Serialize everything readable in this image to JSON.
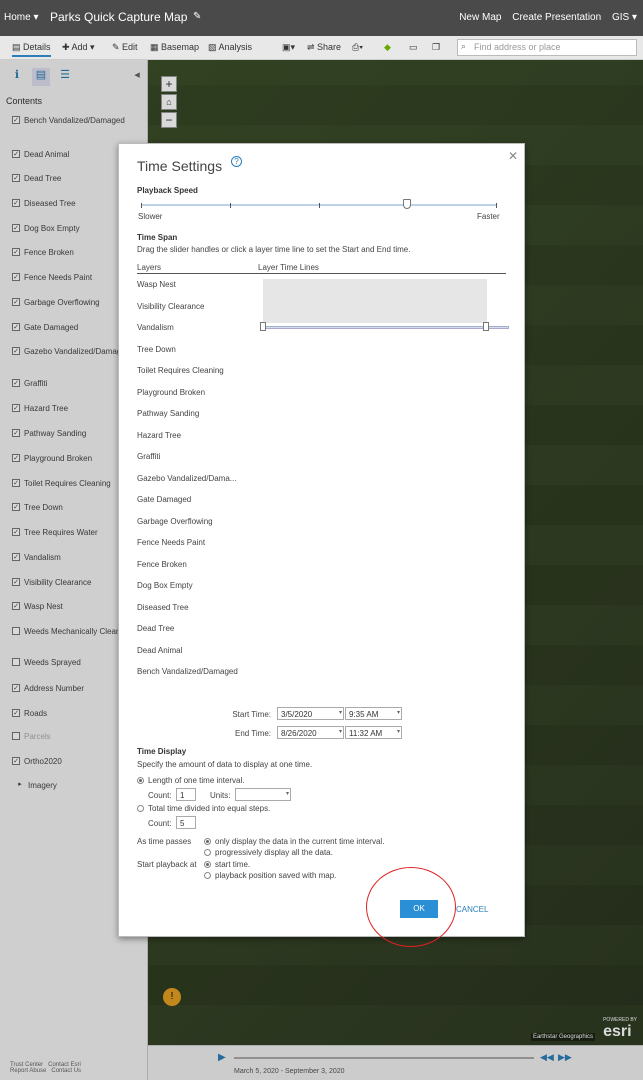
{
  "header": {
    "home_label": "Home ▾",
    "map_title": "Parks Quick Capture Map",
    "new_map": "New Map",
    "create_presentation": "Create Presentation",
    "user": "GIS ▾"
  },
  "toolbar": {
    "details": "Details",
    "add": "Add ▾",
    "edit": "Edit",
    "basemap": "Basemap",
    "analysis": "Analysis",
    "share": "Share",
    "search_placeholder": "Find address or place"
  },
  "sidebar": {
    "contents_label": "Contents",
    "layers": [
      {
        "label": "Bench Vandalized/Damaged",
        "checked": true
      },
      {
        "label": "Dead Animal",
        "checked": true
      },
      {
        "label": "Dead Tree",
        "checked": true
      },
      {
        "label": "Diseased Tree",
        "checked": true
      },
      {
        "label": "Dog Box Empty",
        "checked": true
      },
      {
        "label": "Fence Broken",
        "checked": true
      },
      {
        "label": "Fence Needs Paint",
        "checked": true
      },
      {
        "label": "Garbage Overflowing",
        "checked": true
      },
      {
        "label": "Gate Damaged",
        "checked": true
      },
      {
        "label": "Gazebo Vandalized/Damaged",
        "checked": true
      },
      {
        "label": "Graffiti",
        "checked": true
      },
      {
        "label": "Hazard Tree",
        "checked": true
      },
      {
        "label": "Pathway Sanding",
        "checked": true
      },
      {
        "label": "Playground Broken",
        "checked": true
      },
      {
        "label": "Toilet Requires Cleaning",
        "checked": true
      },
      {
        "label": "Tree Down",
        "checked": true
      },
      {
        "label": "Tree Requires Water",
        "checked": true
      },
      {
        "label": "Vandalism",
        "checked": true
      },
      {
        "label": "Visibility Clearance",
        "checked": true
      },
      {
        "label": "Wasp Nest",
        "checked": true
      },
      {
        "label": "Weeds Mechanically Cleared",
        "checked": false
      },
      {
        "label": "Weeds Sprayed",
        "checked": false
      },
      {
        "label": "Address Number",
        "checked": true
      },
      {
        "label": "Roads",
        "checked": true
      },
      {
        "label": "Parcels",
        "checked": false
      },
      {
        "label": "Ortho2020",
        "checked": true
      },
      {
        "label": "Imagery",
        "checked": false
      }
    ],
    "footer_trust": "Trust Center",
    "footer_contact": "Contact Esri",
    "footer_report": "Report Abuse",
    "footer_contact_us": "Contact Us"
  },
  "map": {
    "attribution": "Earthstar Geographics",
    "esri_powered": "POWERED BY",
    "esri": "esri"
  },
  "timebar": {
    "range_label": "March 5, 2020 - September 3, 2020"
  },
  "dialog": {
    "title": "Time Settings",
    "playback_speed_label": "Playback Speed",
    "slower": "Slower",
    "faster": "Faster",
    "time_span_label": "Time Span",
    "time_span_help": "Drag the slider handles or click a layer time line to set the Start and End time.",
    "col_layers": "Layers",
    "col_timelines": "Layer Time Lines",
    "layer_list": [
      "Wasp Nest",
      "Visibility Clearance",
      "Vandalism",
      "Tree Down",
      "Toilet Requires Cleaning",
      "Playground Broken",
      "Pathway Sanding",
      "Hazard Tree",
      "Graffiti",
      "Gazebo Vandalized/Dama...",
      "Gate Damaged",
      "Garbage Overflowing",
      "Fence Needs Paint",
      "Fence Broken",
      "Dog Box Empty",
      "Diseased Tree",
      "Dead Tree",
      "Dead Animal",
      "Bench Vandalized/Damaged"
    ],
    "start_time_label": "Start Time:",
    "start_date": "3/5/2020",
    "start_time": "9:35 AM",
    "end_time_label": "End Time:",
    "end_date": "8/26/2020",
    "end_time": "11:32 AM",
    "time_display_label": "Time Display",
    "time_display_help": "Specify the amount of data to display at one time.",
    "opt_interval": "Length of one time interval.",
    "count_label": "Count:",
    "count_value": "1",
    "units_label": "Units:",
    "units_value": "",
    "opt_equal_steps": "Total time divided into equal steps.",
    "count2_label": "Count:",
    "count2_value": "5",
    "as_time_passes": "As time passes",
    "opt_only_current": "only display the data in the current time interval.",
    "opt_progressive": "progressively display all the data.",
    "start_playback_at": "Start playback at",
    "opt_start_time": "start time.",
    "opt_saved_position": "playback position saved with map.",
    "ok": "OK",
    "cancel": "CANCEL"
  },
  "colors": {
    "accent": "#2a8fd4",
    "annotation": "#dd2222"
  }
}
